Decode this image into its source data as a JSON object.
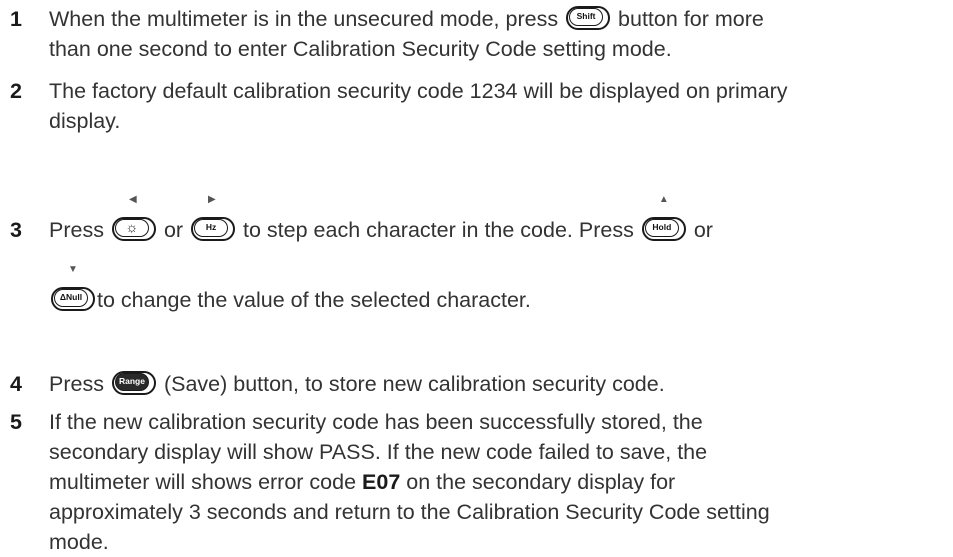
{
  "steps": [
    {
      "number": "1",
      "lines": [
        {
          "before": "When the multimeter is in the unsecured mode, press",
          "button": "Shift",
          "after": "button for more"
        },
        {
          "text": "than one second to enter Calibration Security Code setting mode."
        }
      ]
    },
    {
      "number": "2",
      "lines": [
        {
          "text": "The factory default calibration security code 1234 will be displayed on primary"
        },
        {
          "text": "display."
        }
      ]
    },
    {
      "number": "3",
      "press": "Press",
      "or1": "or",
      "mid": "to step each character in the code. Press",
      "or2": "or",
      "end": "to change the value of the selected character.",
      "buttons": {
        "left": {
          "label": "☼",
          "arrow": "◀",
          "icon": "brightness-icon"
        },
        "right": {
          "label": "Hz",
          "arrow": "▶"
        },
        "up": {
          "label": "Hold",
          "arrow": "▲"
        },
        "down": {
          "label": "ΔNull",
          "arrow": "▼"
        }
      }
    },
    {
      "number": "4",
      "before": "Press",
      "button": "Range",
      "after": "(Save) button, to store new calibration security code."
    },
    {
      "number": "5",
      "line1": "If the new calibration security code has been successfully stored, the",
      "line2": "secondary display will show PASS. If the new code failed to save, the",
      "line3_before": "multimeter will shows error code",
      "error_code": "E07",
      "line3_after": "on the secondary display for",
      "line4": "approximately 3 seconds and return to the Calibration Security Code setting",
      "line5": "mode."
    }
  ]
}
